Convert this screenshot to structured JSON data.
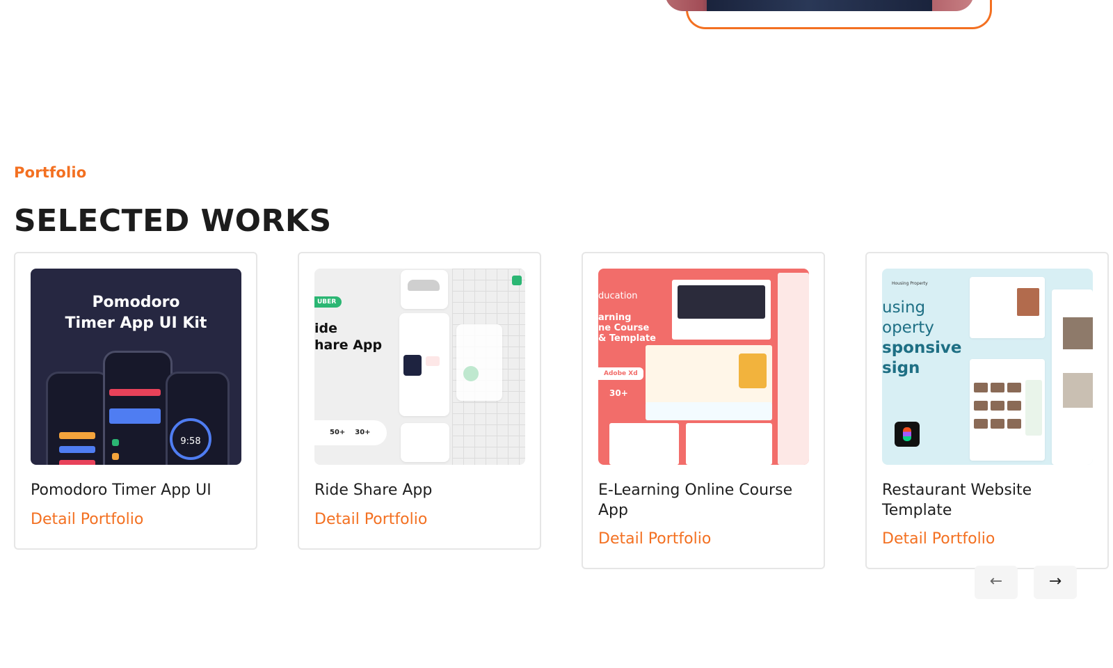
{
  "section": {
    "eyebrow": "Portfolio",
    "title": "SELECTED WORKS"
  },
  "projects": [
    {
      "title": "Pomodoro Timer App UI",
      "link": "Detail Portfolio",
      "thumb": {
        "heading_line1": "Pomodoro",
        "heading_line2": "Timer App UI  Kit",
        "timer": "9:58"
      }
    },
    {
      "title": "Ride Share App",
      "link": "Detail Portfolio",
      "thumb": {
        "badge": "UBER",
        "heading_line1": "ide",
        "heading_line2": "hare App",
        "stat1": "50+",
        "stat2": "30+"
      }
    },
    {
      "title": "E-Learning Online Course App",
      "link": "Detail Portfolio",
      "thumb": {
        "heading_line1": "ducation",
        "heading_line2": "arning",
        "heading_line3": "ne Course",
        "heading_line4": "& Template",
        "badge": "Adobe Xd",
        "stat": "30+"
      }
    },
    {
      "title": "Restaurant Website Template",
      "link": "Detail Portfolio",
      "thumb": {
        "label": "Housing Property",
        "heading_line1": "using",
        "heading_line2": "operty",
        "heading_line3": "sponsive",
        "heading_line4": "sign"
      }
    }
  ],
  "nav": {
    "prev_icon": "arrow-left-icon",
    "next_icon": "arrow-right-icon",
    "prev_glyph": "←",
    "next_glyph": "→"
  },
  "colors": {
    "accent": "#f37021",
    "heading": "#1c1c1c",
    "card_border": "#e6e6e6"
  }
}
